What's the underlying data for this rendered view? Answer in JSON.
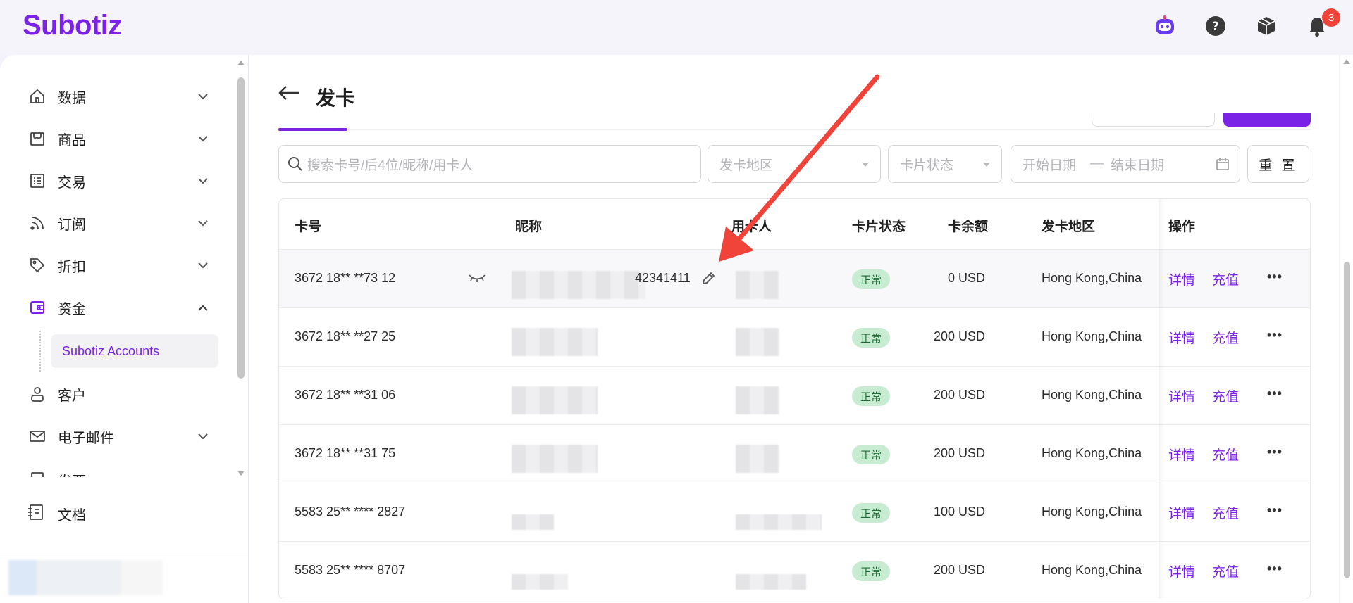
{
  "app": {
    "logo": "Subotiz",
    "notification_count": "3",
    "icons": [
      "bot-icon",
      "help-icon",
      "package-icon",
      "bell-icon"
    ]
  },
  "sidebar": {
    "items": [
      {
        "label": "数据",
        "icon": "home-icon",
        "expanded": false
      },
      {
        "label": "商品",
        "icon": "store-icon",
        "expanded": false
      },
      {
        "label": "交易",
        "icon": "list-icon",
        "expanded": false
      },
      {
        "label": "订阅",
        "icon": "rss-icon",
        "expanded": false
      },
      {
        "label": "折扣",
        "icon": "tag-icon",
        "expanded": false
      },
      {
        "label": "资金",
        "icon": "wallet-icon",
        "expanded": true
      },
      {
        "label": "客户",
        "icon": "user-icon",
        "expanded": false
      },
      {
        "label": "电子邮件",
        "icon": "mail-icon",
        "expanded": false
      },
      {
        "label": "发票",
        "icon": "invoice-icon",
        "expanded": false
      }
    ],
    "sub_item": "Subotiz Accounts",
    "docs_label": "文档"
  },
  "page": {
    "title": "发卡"
  },
  "filters": {
    "search_placeholder": "搜索卡号/后4位/昵称/用卡人",
    "region_placeholder": "发卡地区",
    "status_placeholder": "卡片状态",
    "start_date_placeholder": "开始日期",
    "date_separator": "—",
    "end_date_placeholder": "结束日期",
    "reset_label": "重 置"
  },
  "table": {
    "headers": {
      "card_no": "卡号",
      "nickname": "昵称",
      "holder": "用卡人",
      "status": "卡片状态",
      "balance": "卡余额",
      "region": "发卡地区",
      "actions": "操作"
    },
    "rows": [
      {
        "card_no": "3672 18** **73 12",
        "nickname_tail": "42341411",
        "status": "正常",
        "balance": "0 USD",
        "region": "Hong Kong,China",
        "detail": "详情",
        "recharge": "充值"
      },
      {
        "card_no": "3672 18** **27 25",
        "nickname_tail": "",
        "status": "正常",
        "balance": "200 USD",
        "region": "Hong Kong,China",
        "detail": "详情",
        "recharge": "充值"
      },
      {
        "card_no": "3672 18** **31 06",
        "nickname_tail": "",
        "status": "正常",
        "balance": "200 USD",
        "region": "Hong Kong,China",
        "detail": "详情",
        "recharge": "充值"
      },
      {
        "card_no": "3672 18** **31 75",
        "nickname_tail": "",
        "status": "正常",
        "balance": "200 USD",
        "region": "Hong Kong,China",
        "detail": "详情",
        "recharge": "充值"
      },
      {
        "card_no": "5583 25** **** 2827",
        "nickname_tail": "",
        "status": "正常",
        "balance": "100 USD",
        "region": "Hong Kong,China",
        "detail": "详情",
        "recharge": "充值"
      },
      {
        "card_no": "5583 25** **** 8707",
        "nickname_tail": "",
        "status": "正常",
        "balance": "200 USD",
        "region": "Hong Kong,China",
        "detail": "详情",
        "recharge": "充值"
      }
    ],
    "more_label": "•••"
  },
  "colors": {
    "accent": "#7a22e6",
    "status_bg": "#c8ecd2",
    "annotation_arrow": "#f0443b"
  }
}
